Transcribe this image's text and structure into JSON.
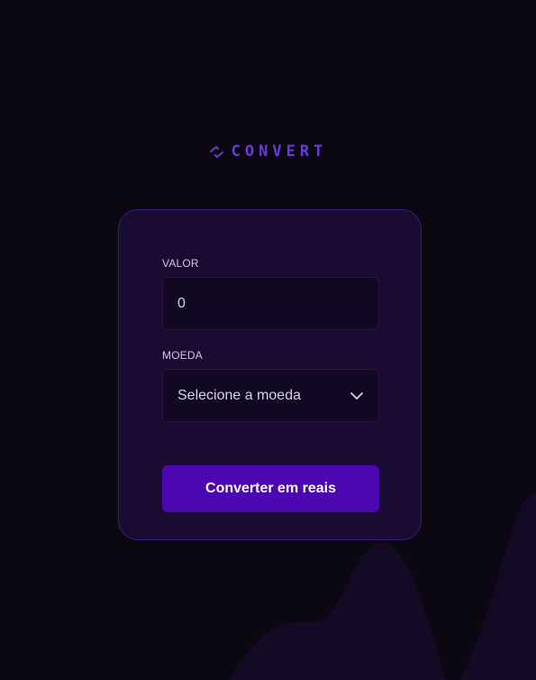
{
  "brand": {
    "logo_text": "CONVERT",
    "accent_color": "#6a3ad4"
  },
  "form": {
    "amount": {
      "label": "VALOR",
      "value": "0"
    },
    "currency": {
      "label": "MOEDA",
      "selected": "Selecione a moeda"
    },
    "submit_label": "Converter em reais"
  },
  "colors": {
    "background": "#0b0812",
    "card": "#1a0b33",
    "button": "#4c07b0"
  },
  "icons": [
    "arrows-exchange-icon",
    "chevron-down-icon"
  ]
}
